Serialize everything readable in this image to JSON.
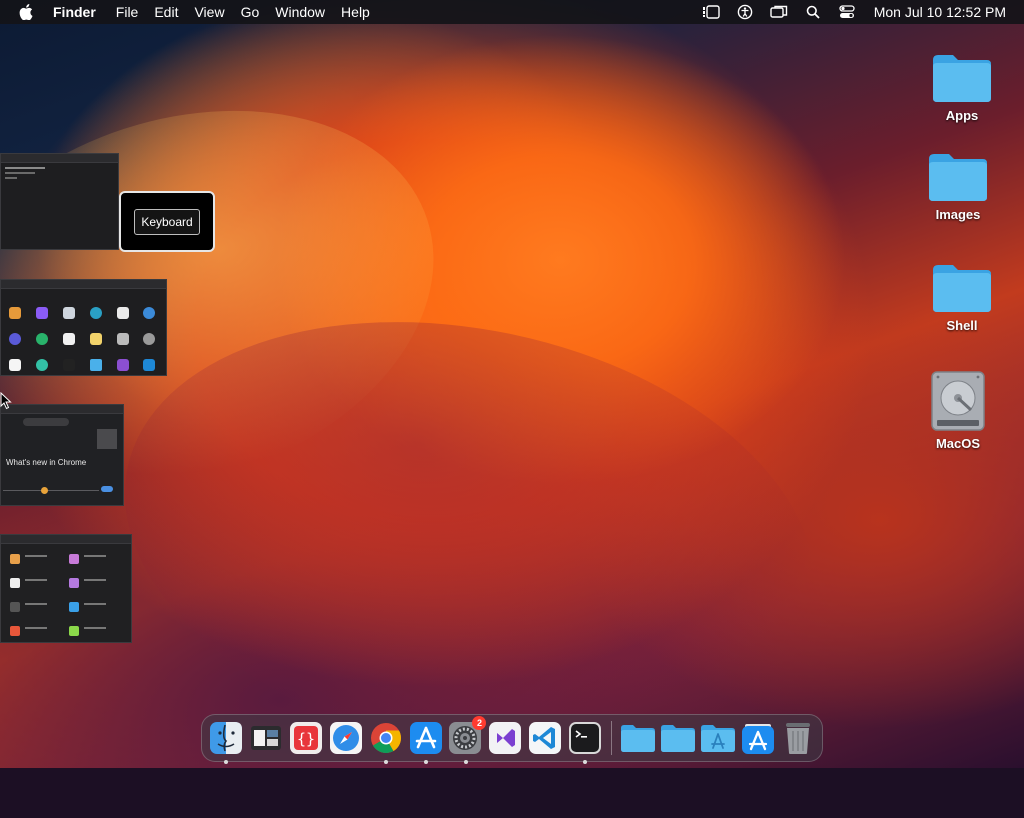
{
  "menubar": {
    "apple_icon": "apple-logo-icon",
    "app_name": "Finder",
    "menus": [
      "File",
      "Edit",
      "View",
      "Go",
      "Window",
      "Help"
    ],
    "status_icons": [
      "stage-manager-icon",
      "accessibility-icon",
      "screen-mirroring-icon",
      "search-icon",
      "control-center-icon"
    ],
    "clock": "Mon Jul 10  12:52 PM"
  },
  "desktop": {
    "icons": [
      {
        "label": "Apps",
        "icon": "folder-icon"
      },
      {
        "label": "Images",
        "icon": "folder-icon"
      },
      {
        "label": "Shell",
        "icon": "folder-icon"
      },
      {
        "label": "MacOS",
        "icon": "hard-drive-icon"
      }
    ]
  },
  "app_switcher": {
    "keyboard_label": "Keyboard",
    "chrome_thumb_text": "What's new in Chrome"
  },
  "dock": {
    "apps": [
      {
        "name": "Finder",
        "icon": "finder-icon",
        "running": true
      },
      {
        "name": "Split Screen",
        "icon": "split-screen-icon",
        "running": false
      },
      {
        "name": "Brackets",
        "icon": "code-braces-icon",
        "running": false
      },
      {
        "name": "Safari",
        "icon": "safari-compass-icon",
        "running": false
      },
      {
        "name": "Google Chrome",
        "icon": "chrome-icon",
        "running": true
      },
      {
        "name": "App Store",
        "icon": "app-store-icon",
        "running": true
      },
      {
        "name": "System Settings",
        "icon": "gear-icon",
        "running": true,
        "badge": "2"
      },
      {
        "name": "Visual Studio",
        "icon": "visual-studio-icon",
        "running": false
      },
      {
        "name": "Visual Studio Code",
        "icon": "vscode-icon",
        "running": false
      },
      {
        "name": "Terminal",
        "icon": "terminal-icon",
        "running": true
      }
    ],
    "stacks": [
      {
        "name": "Folder",
        "icon": "folder-icon"
      },
      {
        "name": "Folder",
        "icon": "folder-icon"
      },
      {
        "name": "Applications",
        "icon": "applications-folder-icon"
      },
      {
        "name": "Downloads",
        "icon": "app-store-download-icon"
      },
      {
        "name": "Trash",
        "icon": "trash-icon"
      }
    ]
  },
  "colors": {
    "folder_blue": "#5bbdf0",
    "menubar_bg": "#141418",
    "badge_red": "#ff3b30"
  }
}
